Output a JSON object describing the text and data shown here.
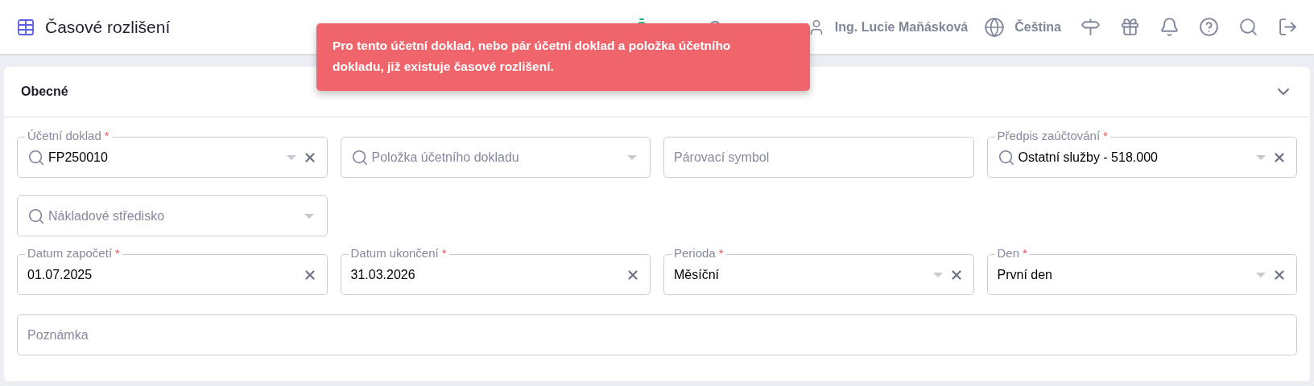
{
  "header": {
    "title": "Časové rozlišení",
    "user": "Ing. Lucie Maňásková",
    "language": "Čeština"
  },
  "toast": {
    "message": "Pro tento účetní doklad, nebo pár účetní doklad a položka účetního dokladu, již existuje časové rozlišení."
  },
  "section": {
    "title": "Obecné",
    "expanded": true
  },
  "rows": [
    [
      {
        "label": "Účetní doklad",
        "required_marker": "*",
        "value": "FP250010",
        "search": true,
        "dropdown": true,
        "clearable": true
      },
      {
        "placeholder": "Položka účetního dokladu",
        "search": true,
        "dropdown": true,
        "clearable": false
      },
      {
        "placeholder": "Párovací symbol",
        "search": false,
        "dropdown": false,
        "clearable": false
      },
      {
        "label": "Předpis zaúčtování",
        "required_marker": "*",
        "value": "Ostatní služby - 518.000",
        "search": true,
        "dropdown": true,
        "clearable": true
      }
    ],
    [
      {
        "placeholder": "Nákladové středisko",
        "search": true,
        "dropdown": true,
        "clearable": false
      }
    ],
    [
      {
        "label": "Datum započetí",
        "required_marker": "*",
        "value": "01.07.2025",
        "search": false,
        "dropdown": false,
        "clearable": true
      },
      {
        "label": "Datum ukončení",
        "required_marker": "*",
        "value": "31.03.2026",
        "search": false,
        "dropdown": false,
        "clearable": true
      },
      {
        "label": "Perioda",
        "required_marker": "*",
        "value": "Měsíční",
        "search": false,
        "dropdown": true,
        "clearable": true
      },
      {
        "label": "Den",
        "required_marker": "*",
        "value": "První den",
        "search": false,
        "dropdown": true,
        "clearable": true
      }
    ]
  ],
  "note": {
    "placeholder": "Poznámka"
  }
}
